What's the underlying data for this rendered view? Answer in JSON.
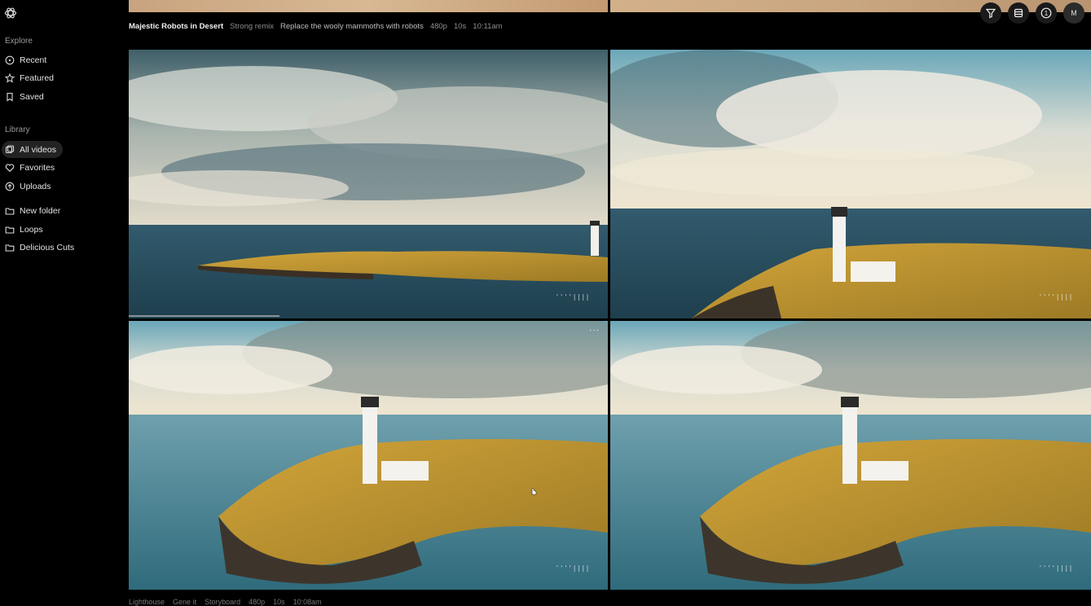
{
  "sidebar": {
    "explore_title": "Explore",
    "explore_items": [
      {
        "label": "Recent",
        "icon": "clock-icon"
      },
      {
        "label": "Featured",
        "icon": "star-icon"
      },
      {
        "label": "Saved",
        "icon": "bookmark-icon"
      }
    ],
    "library_title": "Library",
    "library_items": [
      {
        "label": "All videos",
        "icon": "video-icon",
        "active": true
      },
      {
        "label": "Favorites",
        "icon": "heart-icon"
      },
      {
        "label": "Uploads",
        "icon": "upload-icon"
      }
    ],
    "folders": [
      {
        "label": "New folder",
        "icon": "folder-icon"
      },
      {
        "label": "Loops",
        "icon": "folder-icon"
      },
      {
        "label": "Delicious Cuts",
        "icon": "folder-icon"
      }
    ]
  },
  "header_meta": {
    "title": "Majestic Robots in Desert",
    "remix": "Strong remix",
    "prompt": "Replace the wooly mammoths with robots",
    "resolution": "480p",
    "duration": "10s",
    "time": "10:11am"
  },
  "top_actions": {
    "filter_icon": "filter-icon",
    "view_icon": "list-view-icon",
    "notifications_count": "1",
    "avatar_initial": "M"
  },
  "tiles": [
    {
      "name": "lighthouse-video-1",
      "watermark": "''''||||"
    },
    {
      "name": "lighthouse-video-2",
      "watermark": "''''||||"
    },
    {
      "name": "lighthouse-video-3",
      "watermark": "''''||||",
      "more_label": "···"
    },
    {
      "name": "lighthouse-video-4",
      "watermark": "''''||||"
    }
  ],
  "bottom_row": {
    "title": "Lighthouse",
    "remix": "Gene it",
    "prompt": "Storyboard",
    "resolution": "480p",
    "duration": "10s",
    "time": "10:08am"
  },
  "colors": {
    "background": "#000000",
    "active_nav": "#232323",
    "muted_text": "#8d8d8d"
  }
}
